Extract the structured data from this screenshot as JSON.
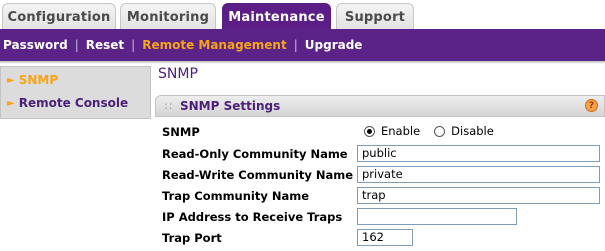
{
  "tabs": [
    {
      "label": "Configuration",
      "active": false
    },
    {
      "label": "Monitoring",
      "active": false
    },
    {
      "label": "Maintenance",
      "active": true
    },
    {
      "label": "Support",
      "active": false
    }
  ],
  "subnav": {
    "items": [
      "Password",
      "Reset",
      "Remote Management",
      "Upgrade"
    ],
    "active": "Remote Management"
  },
  "leftmenu": {
    "items": [
      {
        "label": "SNMP",
        "active": true
      },
      {
        "label": "Remote Console",
        "active": false
      }
    ]
  },
  "main": {
    "page_title": "SNMP",
    "section_title": "SNMP Settings",
    "help_icon": "?",
    "snmp_label": "SNMP",
    "snmp_enable": "Enable",
    "snmp_disable": "Disable",
    "snmp_selected": "Enable",
    "fields": {
      "ro_community": {
        "label": "Read-Only Community Name",
        "value": "public"
      },
      "rw_community": {
        "label": "Read-Write Community Name",
        "value": "private"
      },
      "trap_community": {
        "label": "Trap Community Name",
        "value": "trap"
      },
      "trap_ip": {
        "label": "IP Address to Receive Traps",
        "value": ""
      },
      "trap_port": {
        "label": "Trap Port",
        "value": "162"
      }
    }
  },
  "colors": {
    "brand_purple": "#5b2287",
    "accent_orange": "#f7a41a"
  }
}
